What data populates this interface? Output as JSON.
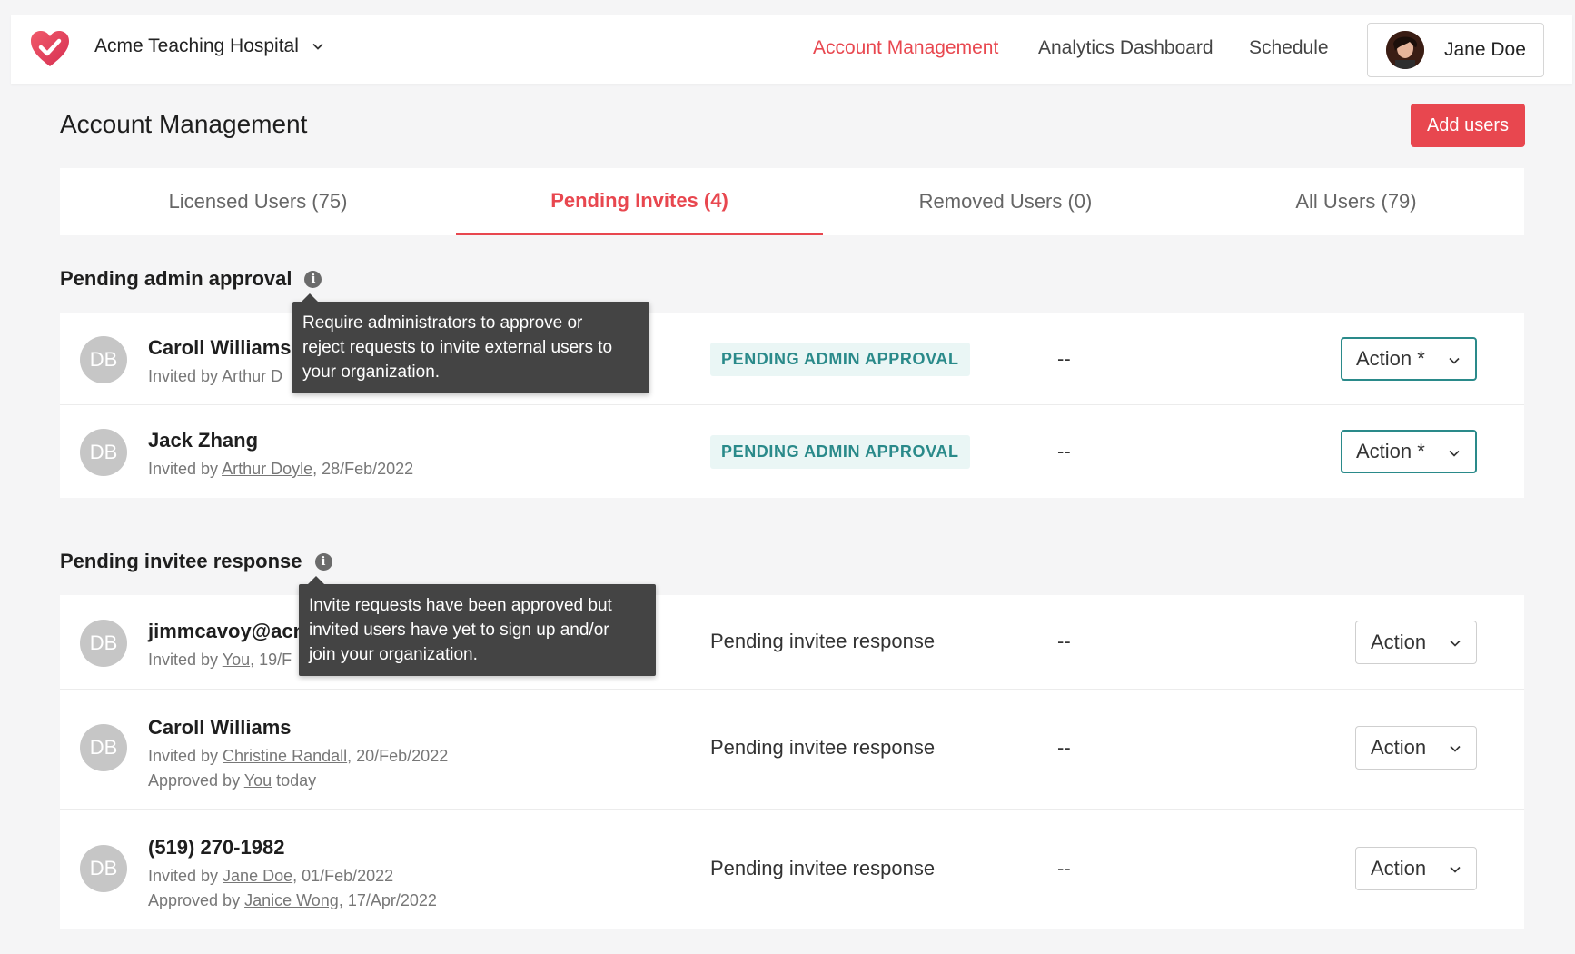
{
  "header": {
    "org_name": "Acme Teaching Hospital",
    "nav": [
      {
        "label": "Account Management",
        "active": true
      },
      {
        "label": "Analytics Dashboard",
        "active": false
      },
      {
        "label": "Schedule",
        "active": false
      }
    ],
    "user_name": "Jane Doe"
  },
  "page": {
    "title": "Account Management",
    "add_users_label": "Add users"
  },
  "tabs": [
    {
      "label": "Licensed Users (75)",
      "active": false
    },
    {
      "label": "Pending Invites (4)",
      "active": true
    },
    {
      "label": "Removed Users (0)",
      "active": false
    },
    {
      "label": "All Users (79)",
      "active": false
    }
  ],
  "sections": {
    "admin_approval": {
      "title": "Pending admin approval",
      "tooltip": [
        "Require administrators to approve or",
        "reject requests to invite external users to",
        "your organization."
      ],
      "rows": [
        {
          "initials": "DB",
          "name": "Caroll Williams",
          "invited_prefix": "Invited by ",
          "invited_by": "Arthur D",
          "status": "PENDING ADMIN APPROVAL",
          "col": "--",
          "action": "Action *"
        },
        {
          "initials": "DB",
          "name": "Jack Zhang",
          "invited_prefix": "Invited by ",
          "invited_by": "Arthur Doyle",
          "invited_date": ", 28/Feb/2022",
          "status": "PENDING ADMIN APPROVAL",
          "col": "--",
          "action": "Action *"
        }
      ]
    },
    "invitee_response": {
      "title": "Pending invitee response",
      "tooltip": [
        "Invite requests have been approved but",
        "invited users have yet to sign up and/or",
        "join your organization."
      ],
      "rows": [
        {
          "initials": "DB",
          "name": "jimmcavoy@acn",
          "invited_prefix": "Invited by ",
          "invited_by": "You",
          "invited_date": ", 19/F",
          "status": "Pending invitee response",
          "col": "--",
          "action": "Action"
        },
        {
          "initials": "DB",
          "name": "Caroll Williams",
          "invited_prefix": "Invited by ",
          "invited_by": "Christine Randall",
          "invited_date": ", 20/Feb/2022",
          "approved_prefix": "Approved by ",
          "approved_by": "You",
          "approved_date": " today",
          "status": "Pending invitee response",
          "col": "--",
          "action": "Action"
        },
        {
          "initials": "DB",
          "name": "(519) 270-1982",
          "invited_prefix": "Invited by ",
          "invited_by": "Jane Doe",
          "invited_date": ", 01/Feb/2022",
          "approved_prefix": "Approved by ",
          "approved_by": "Janice Wong",
          "approved_date": ", 17/Apr/2022",
          "status": "Pending invitee response",
          "col": "--",
          "action": "Action"
        }
      ]
    }
  },
  "colors": {
    "accent": "#e8474f",
    "teal": "#2a8a8a",
    "badge_bg": "#eaf6f5"
  },
  "icons": {
    "logo": "heart-check-icon",
    "chevron": "chevron-down-icon",
    "info": "info-icon"
  }
}
